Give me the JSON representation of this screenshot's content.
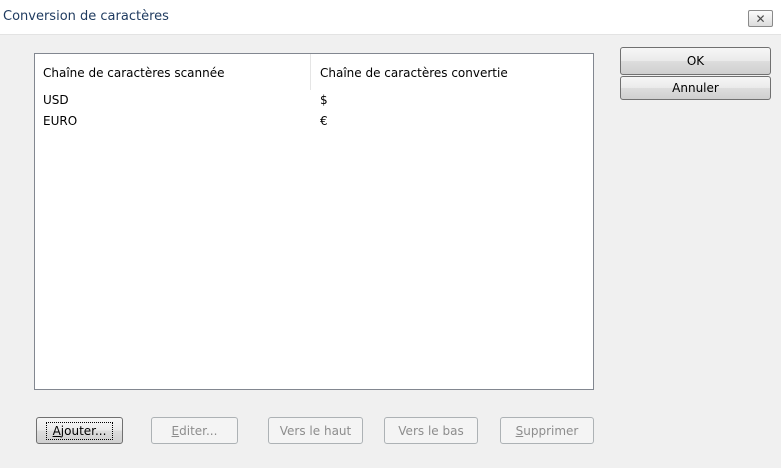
{
  "window": {
    "title": "Conversion de caractères",
    "close_glyph": "✕"
  },
  "table": {
    "columns": [
      "Chaîne de caractères scannée",
      "Chaîne de caractères convertie"
    ],
    "rows": [
      [
        "USD",
        "$"
      ],
      [
        "EURO",
        "€"
      ]
    ]
  },
  "buttons": {
    "ok": "OK",
    "cancel": "Annuler",
    "add_mnemonic": "A",
    "add_rest": "jouter...",
    "edit_mnemonic": "E",
    "edit_rest": "diter...",
    "up": "Vers le haut",
    "down": "Vers le bas",
    "delete_mnemonic": "S",
    "delete_rest": "upprimer"
  },
  "colors": {
    "title_text": "#1e3a5f",
    "disabled_text": "#8d8d8d",
    "dialog_bg": "#f0f0f0"
  }
}
